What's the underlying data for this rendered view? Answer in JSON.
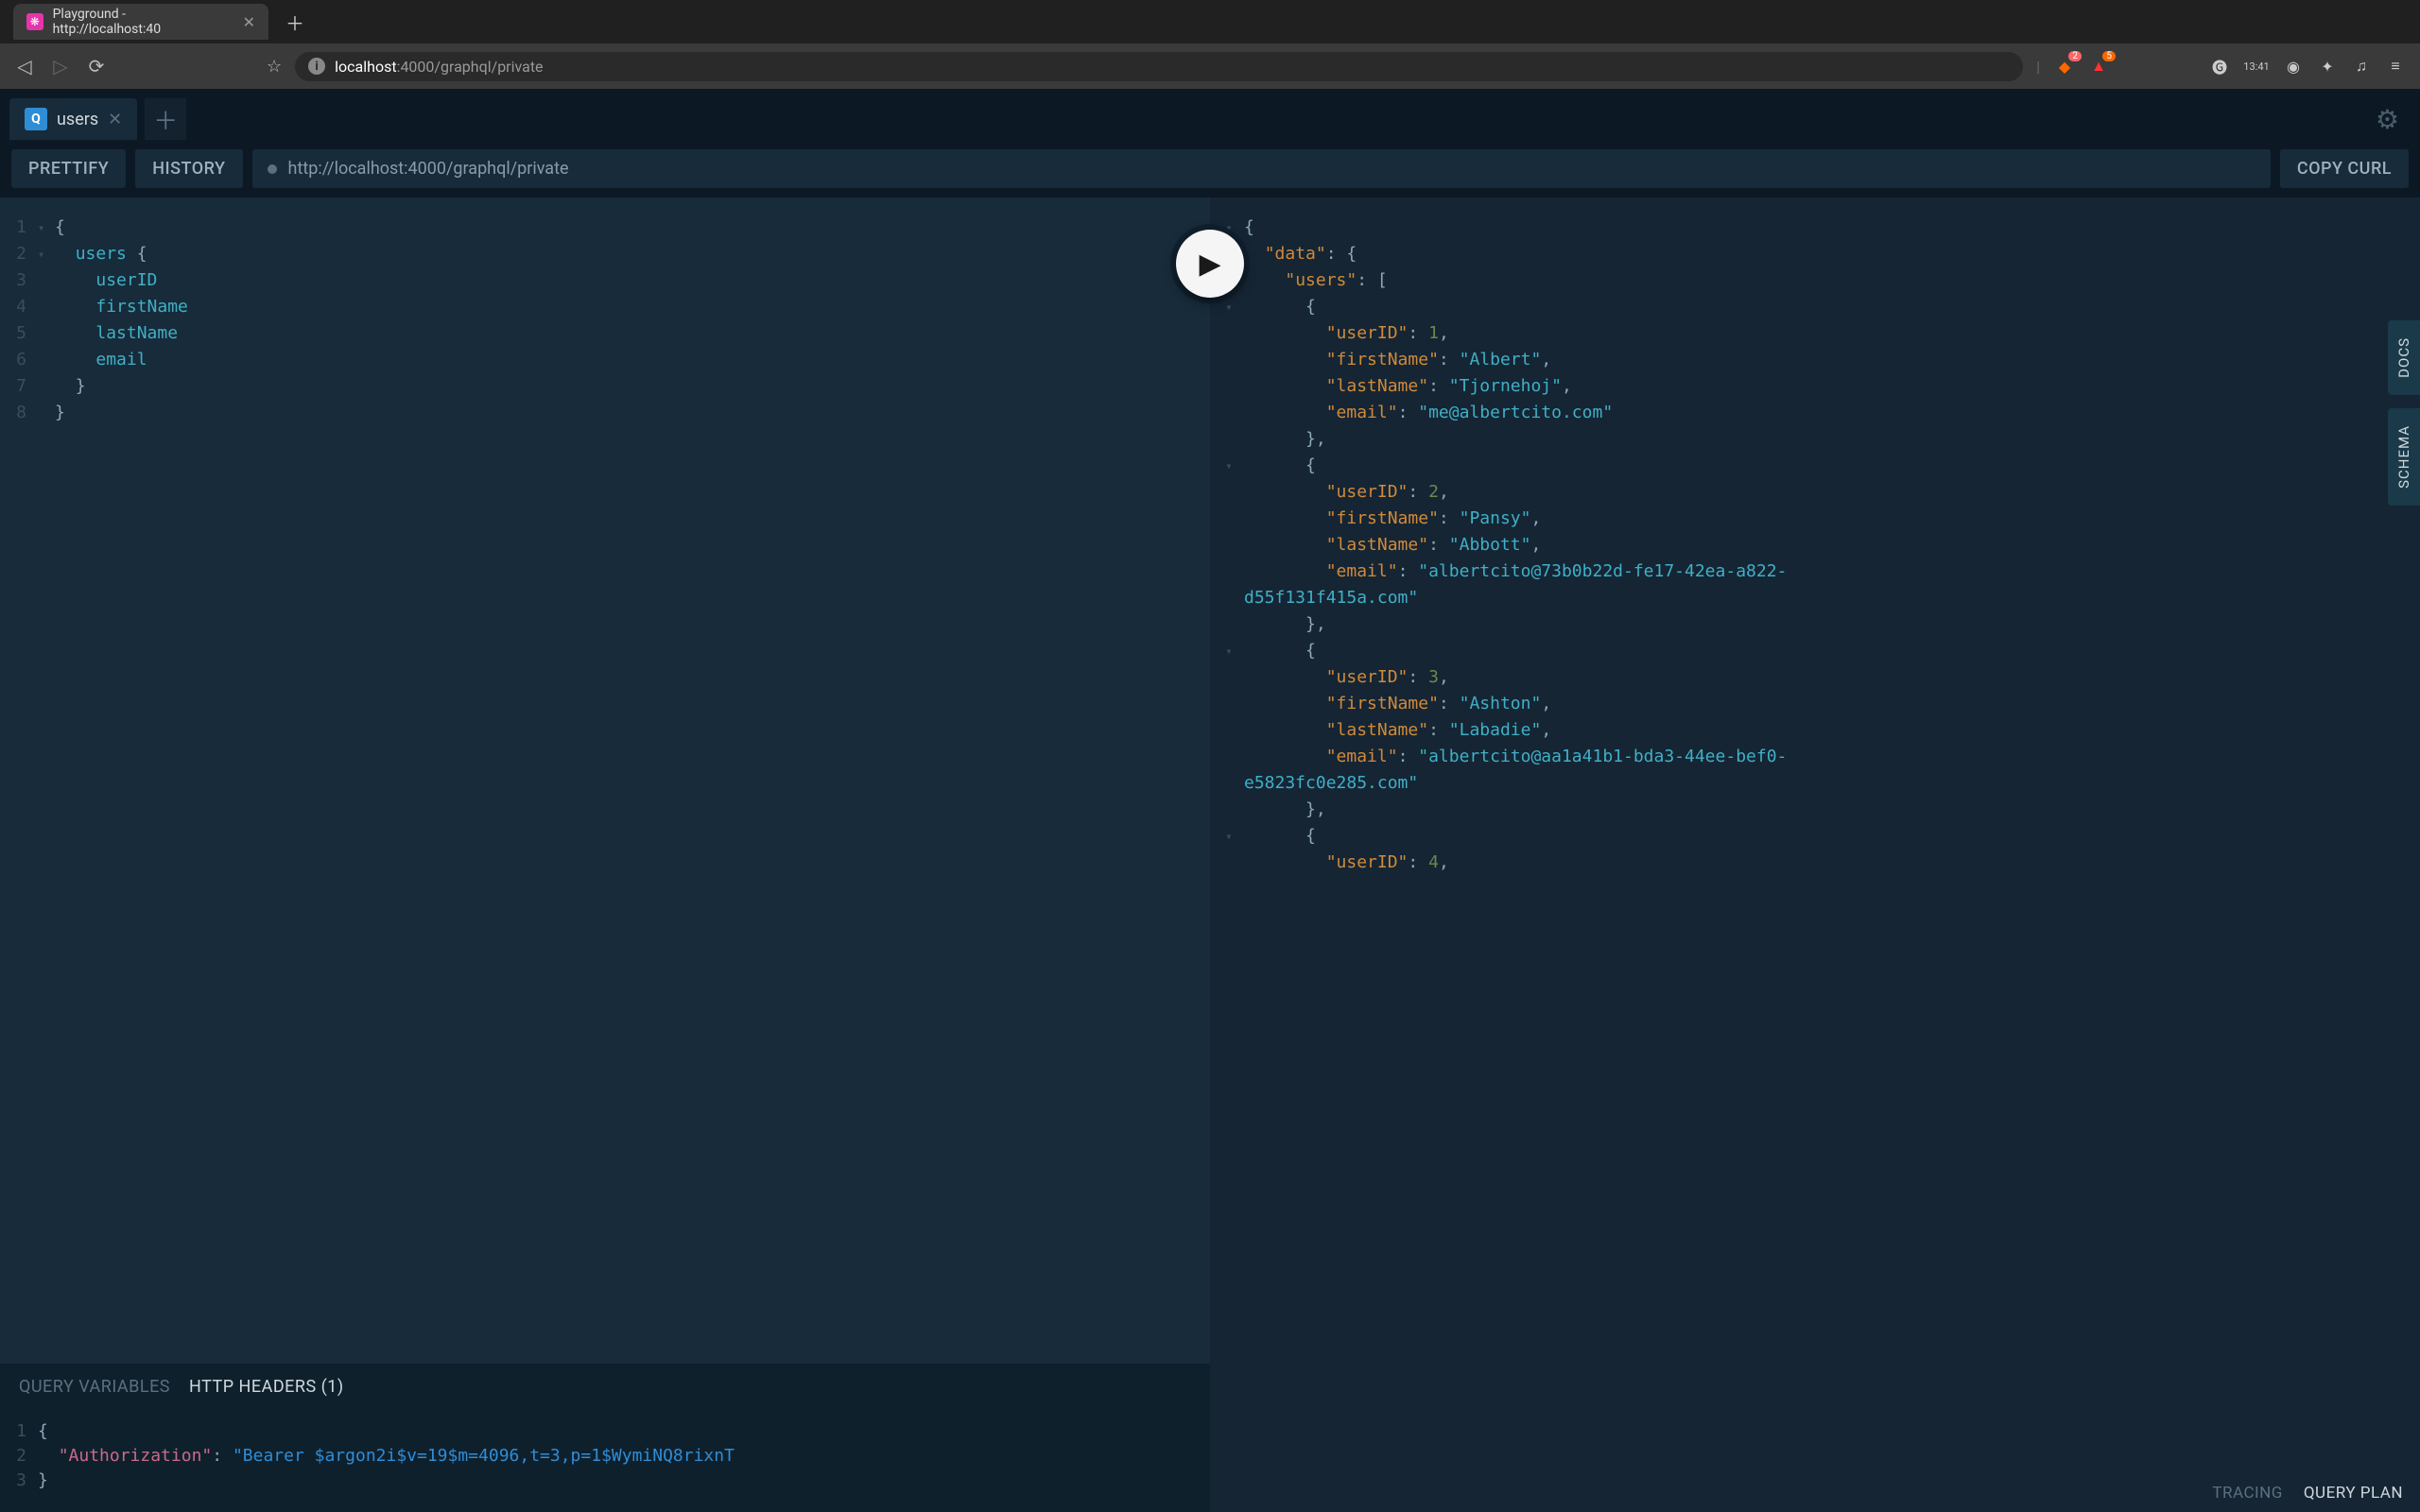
{
  "browser": {
    "tab_title": "Playground - http://localhost:40",
    "url_host": "localhost",
    "url_path": ":4000/graphql/private",
    "clock": "13:41",
    "badge1": "2",
    "badge2": "5"
  },
  "tabs": {
    "active_label": "users"
  },
  "toolbar": {
    "prettify": "PRETTIFY",
    "history": "HISTORY",
    "endpoint": "http://localhost:4000/graphql/private",
    "copy_curl": "COPY CURL"
  },
  "sidebar": {
    "docs": "DOCS",
    "schema": "SCHEMA"
  },
  "footer": {
    "tracing": "TRACING",
    "query_plan": "QUERY PLAN"
  },
  "vars": {
    "tab_vars": "QUERY VARIABLES",
    "tab_headers": "HTTP HEADERS (1)",
    "header_key": "\"Authorization\"",
    "header_val": "\"Bearer $argon2i$v=19$m=4096,t=3,p=1$WymiNQ8rixnT"
  },
  "query": {
    "l1": "{",
    "l2_ind": "  ",
    "l2_fld": "users",
    "l2_brc": " {",
    "l3_ind": "    ",
    "l3": "userID",
    "l4": "firstName",
    "l5": "lastName",
    "l6": "email",
    "l7_ind": "  ",
    "l7": "}",
    "l8": "}"
  },
  "result": {
    "data_key": "\"data\"",
    "users_key": "\"users\"",
    "userID_key": "\"userID\"",
    "firstName_key": "\"firstName\"",
    "lastName_key": "\"lastName\"",
    "email_key": "\"email\"",
    "u1": {
      "id": "1",
      "first": "\"Albert\"",
      "last": "\"Tjornehoj\"",
      "email": "\"me@albertcito.com\""
    },
    "u2": {
      "id": "2",
      "first": "\"Pansy\"",
      "last": "\"Abbott\"",
      "email1": "\"albertcito@73b0b22d-fe17-42ea-a822-",
      "email2": "d55f131f415a.com\""
    },
    "u3": {
      "id": "3",
      "first": "\"Ashton\"",
      "last": "\"Labadie\"",
      "email1": "\"albertcito@aa1a41b1-bda3-44ee-bef0-",
      "email2": "e5823fc0e285.com\""
    },
    "u4": {
      "id": "4"
    }
  }
}
